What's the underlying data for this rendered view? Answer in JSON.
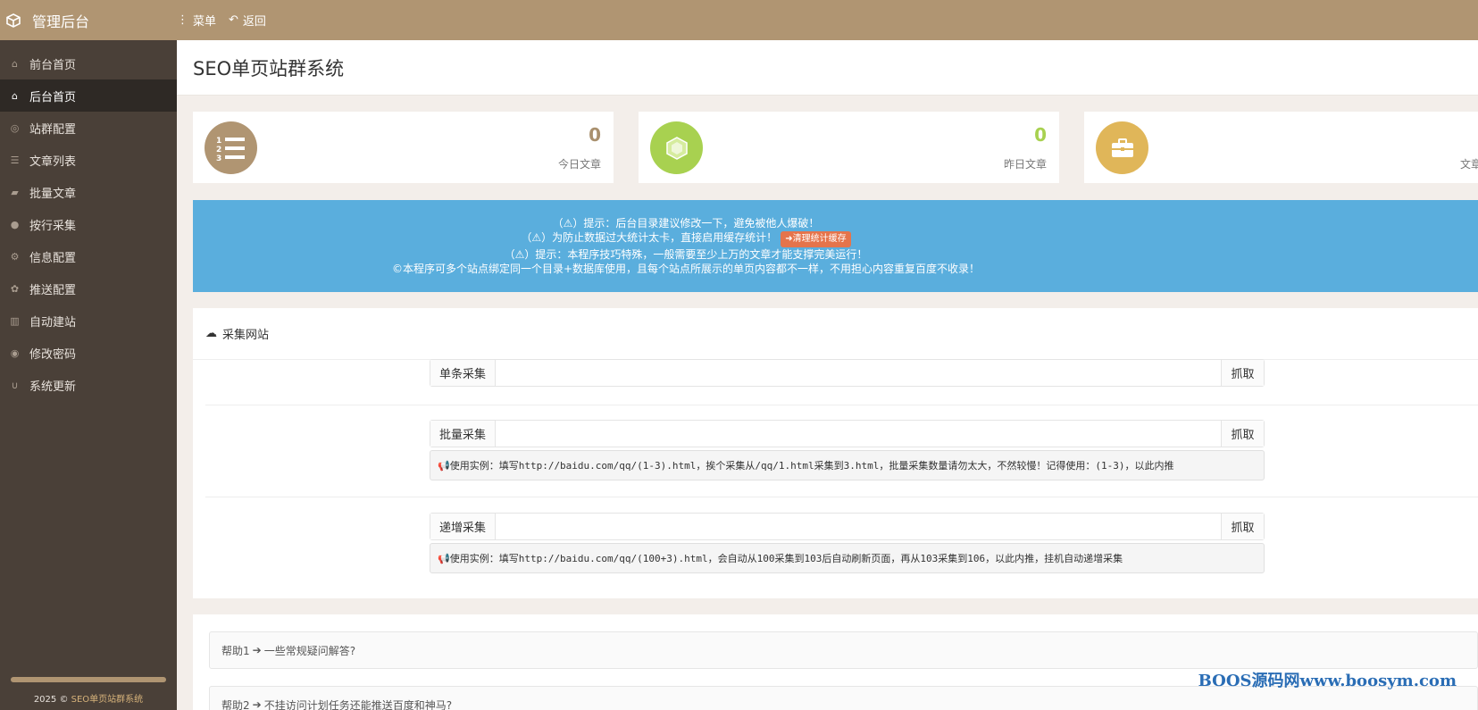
{
  "app": {
    "title": "管理后台"
  },
  "topnav": {
    "menu_label": "菜单",
    "back_label": "返回"
  },
  "sidebar": {
    "items": [
      {
        "label": "前台首页",
        "icon": "home-icon"
      },
      {
        "label": "后台首页",
        "icon": "home-icon",
        "active": true
      },
      {
        "label": "站群配置",
        "icon": "dribbble-icon"
      },
      {
        "label": "文章列表",
        "icon": "list-icon"
      },
      {
        "label": "批量文章",
        "icon": "book-icon"
      },
      {
        "label": "按行采集",
        "icon": "circle-icon"
      },
      {
        "label": "信息配置",
        "icon": "gear-icon"
      },
      {
        "label": "推送配置",
        "icon": "paw-icon"
      },
      {
        "label": "自动建站",
        "icon": "bank-icon"
      },
      {
        "label": "修改密码",
        "icon": "user-circle-icon"
      },
      {
        "label": "系统更新",
        "icon": "magnet-icon"
      }
    ],
    "footer_year": "2025 ©",
    "footer_link": "SEO单页站群系统"
  },
  "page": {
    "title": "SEO单页站群系统"
  },
  "stats": [
    {
      "value": "0",
      "label": "今日文章",
      "color": "#b09572",
      "value_color": "#a9906e",
      "icon": "ordered-list-icon"
    },
    {
      "value": "0",
      "label": "昨日文章",
      "color": "#a8d150",
      "value_color": "#a8d150",
      "icon": "cube-icon"
    },
    {
      "value": "",
      "label": "文章素",
      "color": "#e0b659",
      "value_color": "#e0b659",
      "icon": "briefcase-icon"
    }
  ],
  "notice": {
    "line1": "（⚠）提示：后台目录建议修改一下，避免被他人爆破！",
    "line2": "（⚠）为防止数据过大统计太卡，直接启用缓存统计！",
    "line2_button": "➜清理统计缓存",
    "line3": "（⚠）提示：本程序技巧特殊，一般需要至少上万的文章才能支撑完美运行！",
    "line4": "©本程序可多个站点绑定同一个目录+数据库使用，且每个站点所展示的单页内容都不一样，不用担心内容重复百度不收录！"
  },
  "collect": {
    "title": "采集网站",
    "single": {
      "label": "单条采集",
      "button": "抓取",
      "value": ""
    },
    "batch": {
      "label": "批量采集",
      "button": "抓取",
      "value": "",
      "hint": "使用实例：填写http://baidu.com/qq/(1-3).html，挨个采集从/qq/1.html采集到3.html，批量采集数量请勿太大，不然较慢！记得使用：(1-3)，以此内推"
    },
    "increment": {
      "label": "递增采集",
      "button": "抓取",
      "value": "",
      "hint": "使用实例：填写http://baidu.com/qq/(100+3).html，会自动从100采集到103后自动刷新页面，再从103采集到106，以此内推，挂机自动递增采集"
    }
  },
  "help": [
    {
      "prefix": "帮助1",
      "text": "一些常规疑问解答?"
    },
    {
      "prefix": "帮助2",
      "text": "不挂访问计划任务还能推送百度和神马?"
    }
  ],
  "watermark": "BOOS源码网www.boosym.com"
}
